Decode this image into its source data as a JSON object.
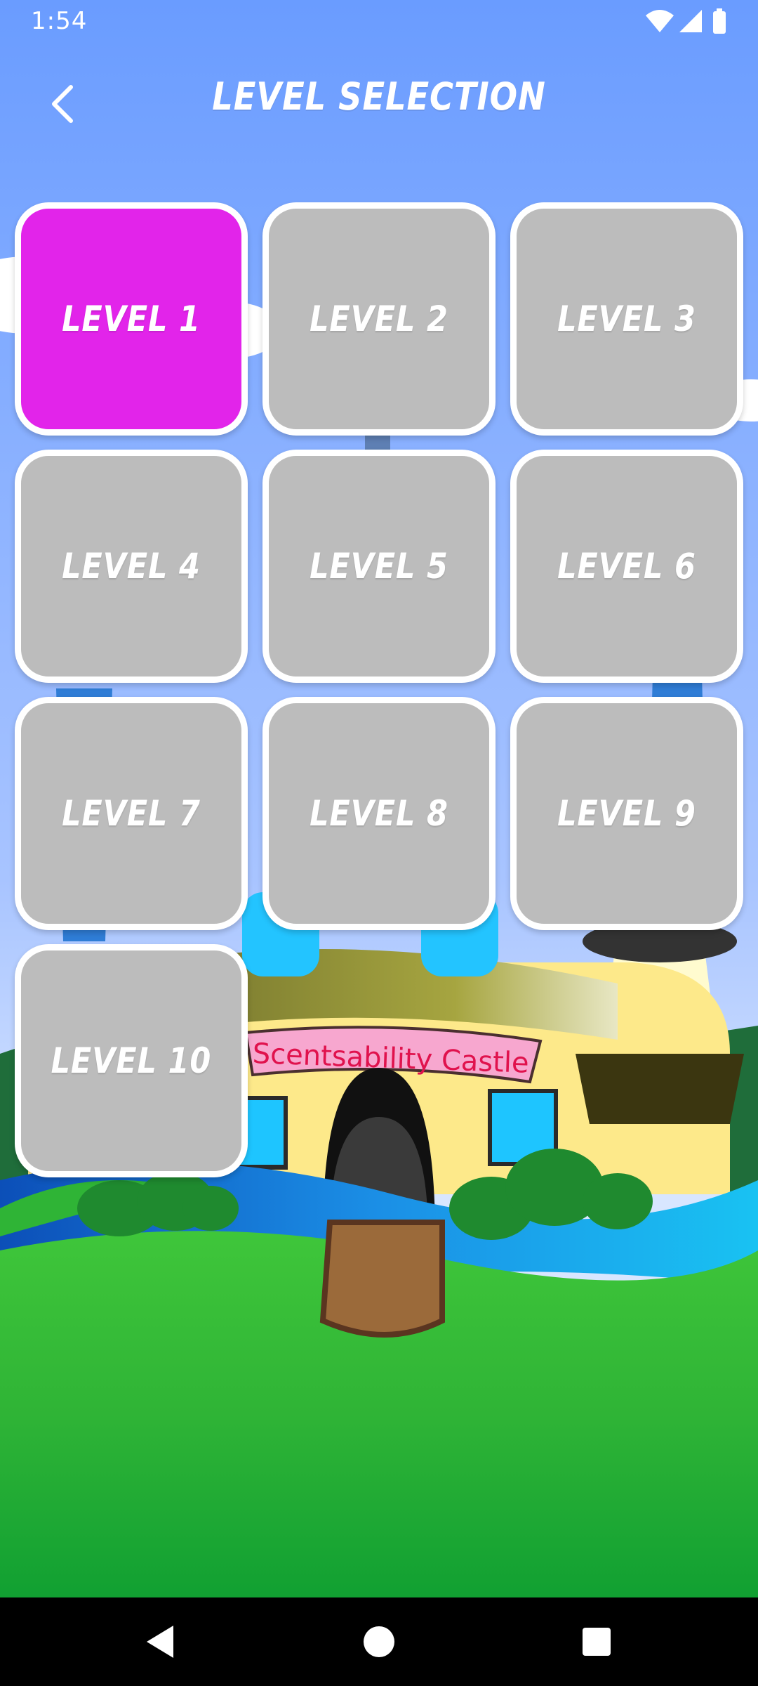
{
  "status_bar": {
    "time": "1:54"
  },
  "header": {
    "title": "LEVEL SELECTION"
  },
  "levels": [
    {
      "label": "LEVEL 1",
      "selected": true
    },
    {
      "label": "LEVEL 2",
      "selected": false
    },
    {
      "label": "LEVEL 3",
      "selected": false
    },
    {
      "label": "LEVEL 4",
      "selected": false
    },
    {
      "label": "LEVEL 5",
      "selected": false
    },
    {
      "label": "LEVEL 6",
      "selected": false
    },
    {
      "label": "LEVEL 7",
      "selected": false
    },
    {
      "label": "LEVEL 8",
      "selected": false
    },
    {
      "label": "LEVEL 9",
      "selected": false
    },
    {
      "label": "LEVEL 10",
      "selected": false
    }
  ],
  "background": {
    "castle_sign": "Scentsability Castle"
  },
  "colors": {
    "sky": "#6a9cff",
    "selected_tile": "#e224ea",
    "locked_tile": "#bcbcbc",
    "tile_border": "#ffffff"
  },
  "icons": {
    "back": "chevron-left-icon",
    "wifi": "wifi-icon",
    "signal": "signal-icon",
    "battery": "battery-icon",
    "nav_back": "nav-back-triangle-icon",
    "nav_home": "nav-home-circle-icon",
    "nav_recents": "nav-recents-square-icon"
  }
}
